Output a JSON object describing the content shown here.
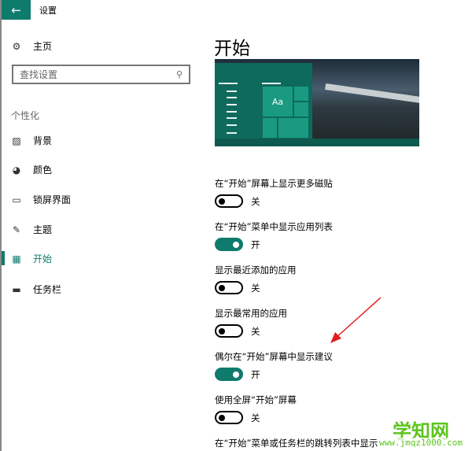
{
  "header": {
    "back_icon": "arrow-left-icon",
    "title": "设置"
  },
  "accent": "#0f7b6c",
  "sidebar": {
    "home": "主页",
    "search_placeholder": "查找设置",
    "section": "个性化",
    "items": [
      {
        "label": "背景",
        "icon": "picture-icon"
      },
      {
        "label": "颜色",
        "icon": "palette-icon"
      },
      {
        "label": "锁屏界面",
        "icon": "lock-screen-icon"
      },
      {
        "label": "主题",
        "icon": "theme-brush-icon"
      },
      {
        "label": "开始",
        "icon": "start-icon",
        "selected": true
      },
      {
        "label": "任务栏",
        "icon": "taskbar-icon"
      }
    ]
  },
  "main": {
    "title": "开始",
    "preview_tile_text": "Aa",
    "settings": [
      {
        "label": "在“开始”屏幕上显示更多磁贴",
        "on": false,
        "state": "关"
      },
      {
        "label": "在“开始”菜单中显示应用列表",
        "on": true,
        "state": "开"
      },
      {
        "label": "显示最近添加的应用",
        "on": false,
        "state": "关"
      },
      {
        "label": "显示最常用的应用",
        "on": false,
        "state": "关"
      },
      {
        "label": "偶尔在“开始”屏幕中显示建议",
        "on": true,
        "state": "开"
      },
      {
        "label": "使用全屏“开始”屏幕",
        "on": false,
        "state": "关"
      }
    ],
    "last_label": "在“开始”菜单或任务栏的跳转列表中显示"
  },
  "watermark": {
    "name": "学知网",
    "url": "www.jmqz1000.com"
  }
}
